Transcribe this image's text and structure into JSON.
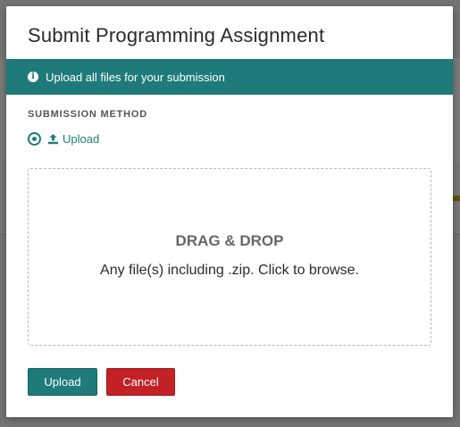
{
  "modal": {
    "title": "Submit Programming Assignment",
    "info_text": "Upload all files for your submission",
    "section_label": "SUBMISSION METHOD",
    "method": {
      "label": "Upload",
      "selected": true
    },
    "dropzone": {
      "title": "DRAG & DROP",
      "subtitle": "Any file(s) including .zip. Click to browse."
    },
    "buttons": {
      "upload": "Upload",
      "cancel": "Cancel"
    }
  },
  "colors": {
    "primary": "#1f7a7a",
    "danger": "#c42127",
    "text": "#2b2b2b"
  },
  "icons": {
    "info": "info-circle-icon",
    "upload": "upload-icon",
    "radio": "radio-selected-icon"
  }
}
